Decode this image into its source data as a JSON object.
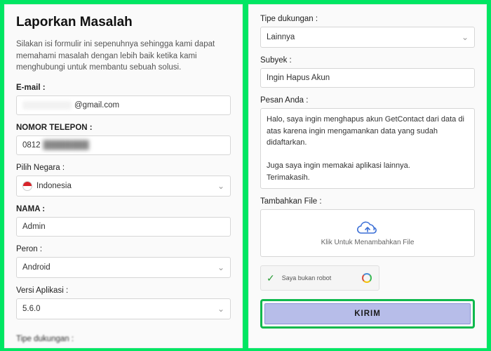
{
  "left": {
    "title": "Laporkan Masalah",
    "intro": "Silakan isi formulir ini sepenuhnya sehingga kami dapat memahami masalah dengan lebih baik ketika kami menghubungi untuk membantu sebuah solusi.",
    "email_label": "E-mail :",
    "email_suffix": "@gmail.com",
    "phone_label": "NOMOR TELEPON :",
    "phone_prefix": "0812",
    "country_label": "Pilih Negara :",
    "country_value": "Indonesia",
    "name_label": "NAMA :",
    "name_value": "Admin",
    "platform_label": "Peron :",
    "platform_value": "Android",
    "version_label": "Versi Aplikasi :",
    "version_value": "5.6.0",
    "support_type_label_cut": "Tipe dukungan :"
  },
  "right": {
    "support_type_label": "Tipe dukungan :",
    "support_type_value": "Lainnya",
    "subject_label": "Subyek :",
    "subject_value": "Ingin Hapus Akun",
    "message_label": "Pesan Anda :",
    "message_value": "Halo, saya ingin menghapus akun GetContact dari data di atas karena ingin mengamankan data yang sudah didaftarkan.\n\nJuga saya ingin memakai aplikasi lainnya.\nTerimakasih.",
    "add_file_label": "Tambahkan File :",
    "upload_hint": "Klik Untuk Menambahkan File",
    "captcha_text": "Saya bukan robot",
    "submit_label": "KIRIM"
  }
}
